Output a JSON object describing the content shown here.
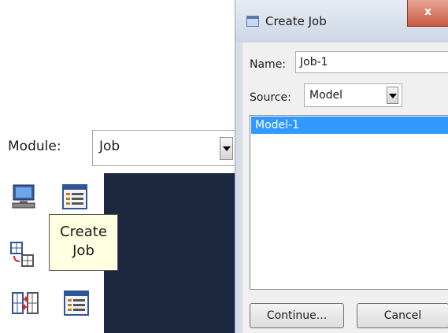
{
  "module": {
    "label": "Module:",
    "value": "Job"
  },
  "toolbox": {
    "tools": [
      {
        "icon": "job-manager-icon"
      },
      {
        "icon": "job-list-icon"
      },
      {
        "icon": "adaptivity-icon"
      },
      {
        "icon": "co-execution-icon"
      },
      {
        "icon": "optimization-icon"
      }
    ]
  },
  "tooltip": {
    "line1": "Create",
    "line2": "Job"
  },
  "dialog": {
    "title": "Create Job",
    "close_label": "x",
    "name_label": "Name:",
    "name_value": "Job-1",
    "source_label": "Source:",
    "source_value": "Model",
    "list_items": [
      "Model-1"
    ],
    "continue_label": "Continue...",
    "cancel_label": "Cancel"
  },
  "colors": {
    "viewport": "#1c2840",
    "selection": "#3399ff",
    "tooltip_bg": "#ffffe1"
  }
}
